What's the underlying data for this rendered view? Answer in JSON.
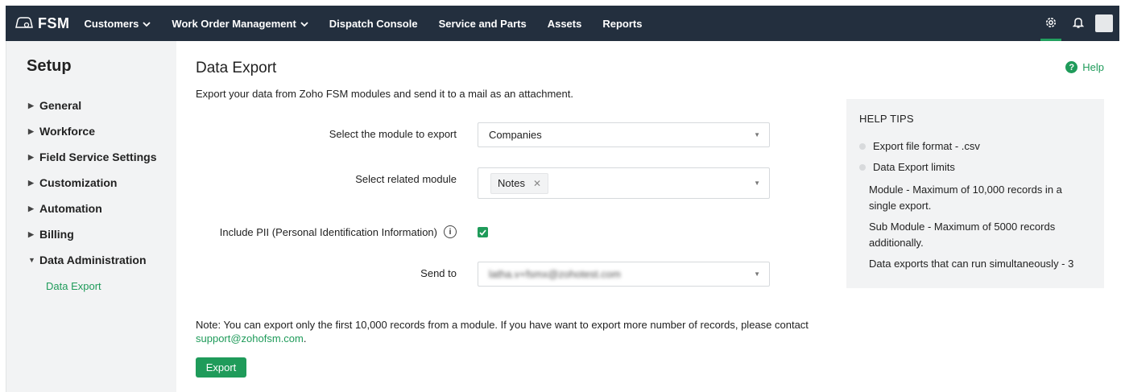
{
  "topbar": {
    "brand": "FSM",
    "nav": [
      {
        "label": "Customers",
        "dropdown": true
      },
      {
        "label": "Work Order Management",
        "dropdown": true
      },
      {
        "label": "Dispatch Console",
        "dropdown": false
      },
      {
        "label": "Service and Parts",
        "dropdown": false
      },
      {
        "label": "Assets",
        "dropdown": false
      },
      {
        "label": "Reports",
        "dropdown": false
      }
    ]
  },
  "sidebar": {
    "title": "Setup",
    "items": [
      {
        "label": "General",
        "expanded": false
      },
      {
        "label": "Workforce",
        "expanded": false
      },
      {
        "label": "Field Service Settings",
        "expanded": false
      },
      {
        "label": "Customization",
        "expanded": false
      },
      {
        "label": "Automation",
        "expanded": false
      },
      {
        "label": "Billing",
        "expanded": false
      },
      {
        "label": "Data Administration",
        "expanded": true
      }
    ],
    "subitem": "Data Export"
  },
  "main": {
    "title": "Data Export",
    "help_label": "Help",
    "subtitle": "Export your data from Zoho FSM modules and send it to a mail as an attachment.",
    "form": {
      "module_label": "Select the module to export",
      "module_value": "Companies",
      "related_label": "Select related module",
      "related_tag": "Notes",
      "pii_label": "Include PII (Personal Identification Information)",
      "pii_checked": true,
      "sendto_label": "Send to",
      "sendto_value": "latha.v+fsmx@zohotest.com"
    },
    "note": "Note: You can export only the first 10,000 records from a module. If you have want to export more number of records, please contact",
    "support_email": "support@zohofsm.com",
    "export_button": "Export"
  },
  "help_tips": {
    "title": "HELP TIPS",
    "format": "Export file format - .csv",
    "limits": "Data Export limits",
    "details": [
      "Module - Maximum of 10,000 records in a single export.",
      "Sub Module - Maximum of 5000 records additionally.",
      "Data exports that can run simultaneously - 3"
    ]
  },
  "colors": {
    "accent": "#1f9b5a",
    "topbar": "#232f3e",
    "panel": "#f2f3f4"
  },
  "icons": [
    "fsm-logo-icon",
    "chevron-down-icon",
    "gear-icon",
    "bell-icon",
    "caret-right-icon",
    "caret-down-icon",
    "help-icon",
    "info-icon",
    "check-icon"
  ]
}
